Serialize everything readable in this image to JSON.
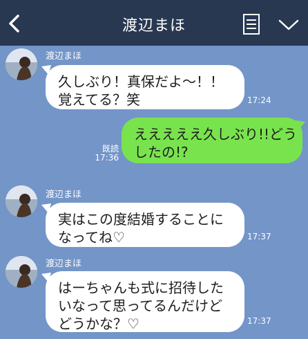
{
  "header": {
    "title": "渡辺まほ",
    "back_icon": "chevron-left-icon",
    "menu_icon": "notes-list-icon",
    "expand_icon": "chevron-down-icon",
    "background_color": "#283851"
  },
  "chat": {
    "background_color": "#7395c8",
    "received_bubble_color": "#ffffff",
    "sent_bubble_color": "#79e34e",
    "messages": [
      {
        "direction": "received",
        "sender": "渡辺まほ",
        "lines": [
          "久しぶり！真保だよ～！！",
          "覚えてる？笑"
        ],
        "time": "17:24"
      },
      {
        "direction": "sent",
        "lines": [
          "えええええ久しぶり!!どう",
          "したの!?"
        ],
        "read_label": "既読",
        "time": "17:36"
      },
      {
        "direction": "received",
        "sender": "渡辺まほ",
        "lines": [
          "実はこの度結婚することに",
          "なってね♡"
        ],
        "time": "17:37"
      },
      {
        "direction": "received",
        "sender": "渡辺まほ",
        "lines": [
          "はーちゃんも式に招待した",
          "いなって思ってるんだけど",
          "どうかな？♡"
        ],
        "time": "17:37"
      }
    ]
  }
}
